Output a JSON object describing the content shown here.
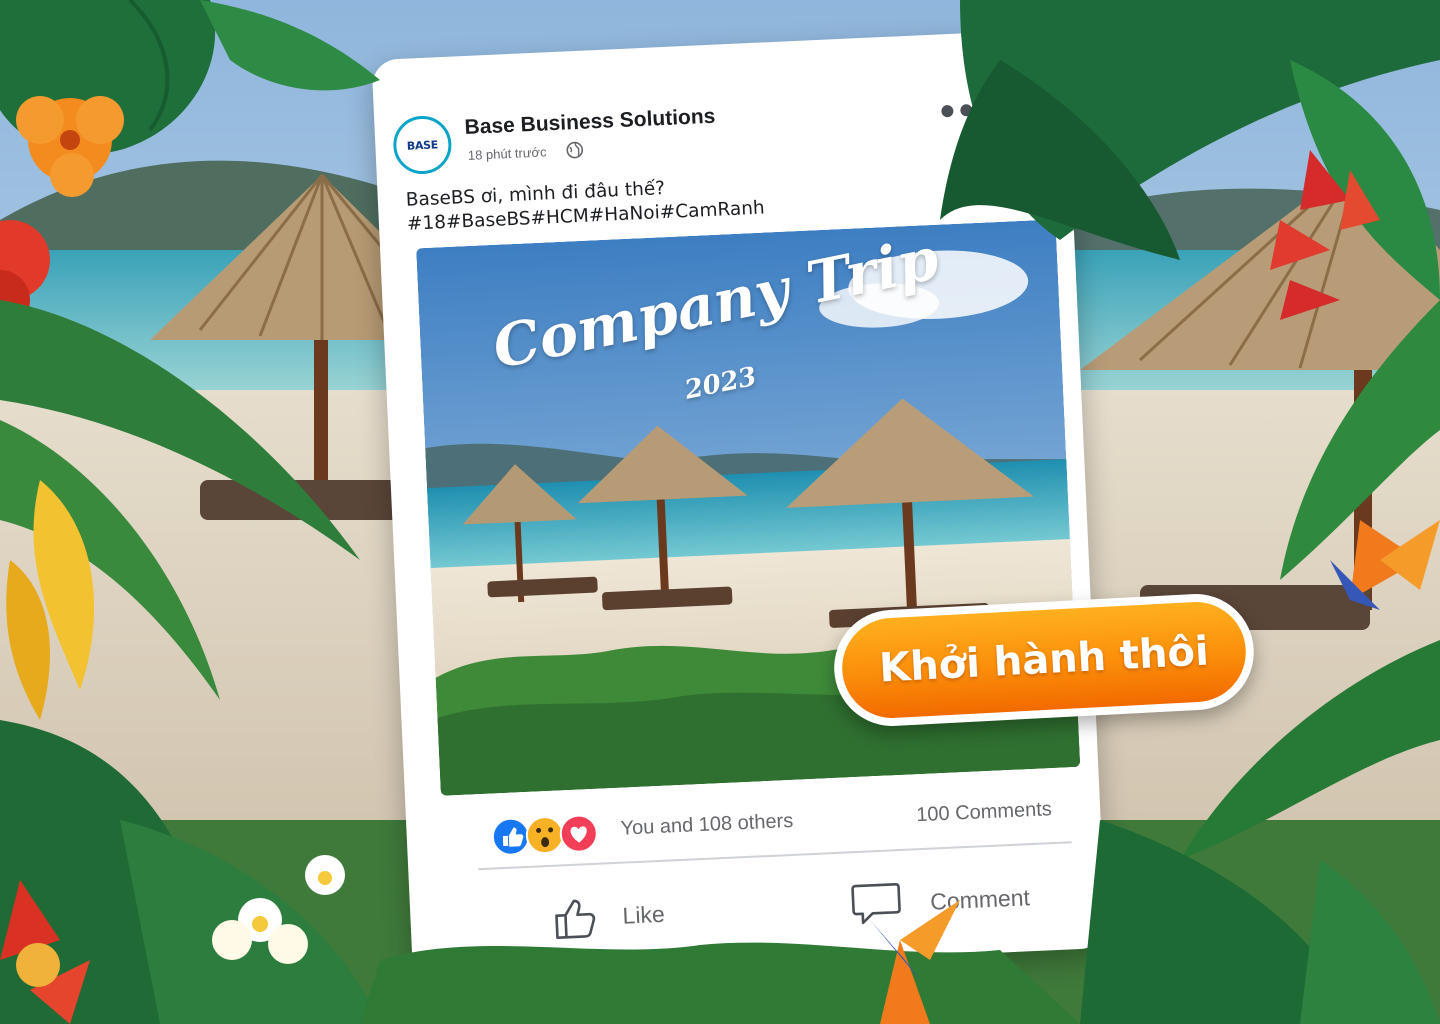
{
  "post": {
    "author": "Base Business Solutions",
    "avatar_text": "BASE",
    "time": "18 phút trước",
    "caption_line1": "BaseBS ơi, mình đi đâu thế?",
    "caption_line2": "#18#BaseBS#HCM#HaNoi#CamRanh",
    "photo_title": "Company Trip",
    "photo_year": "2023"
  },
  "stats": {
    "reactions_text": "You and 108 others",
    "comments_text": "100 Comments",
    "reaction_icons": [
      "like-icon",
      "wow-icon",
      "love-icon"
    ]
  },
  "actions": {
    "like_label": "Like",
    "comment_label": "Comment"
  },
  "cta": {
    "label": "Khởi hành thôi"
  },
  "colors": {
    "accent_orange": "#fb8e0a",
    "facebook_blue": "#1877f2",
    "love_red": "#f33e58",
    "wow_yellow": "#f7b125",
    "avatar_ring": "#0aa4c8"
  }
}
